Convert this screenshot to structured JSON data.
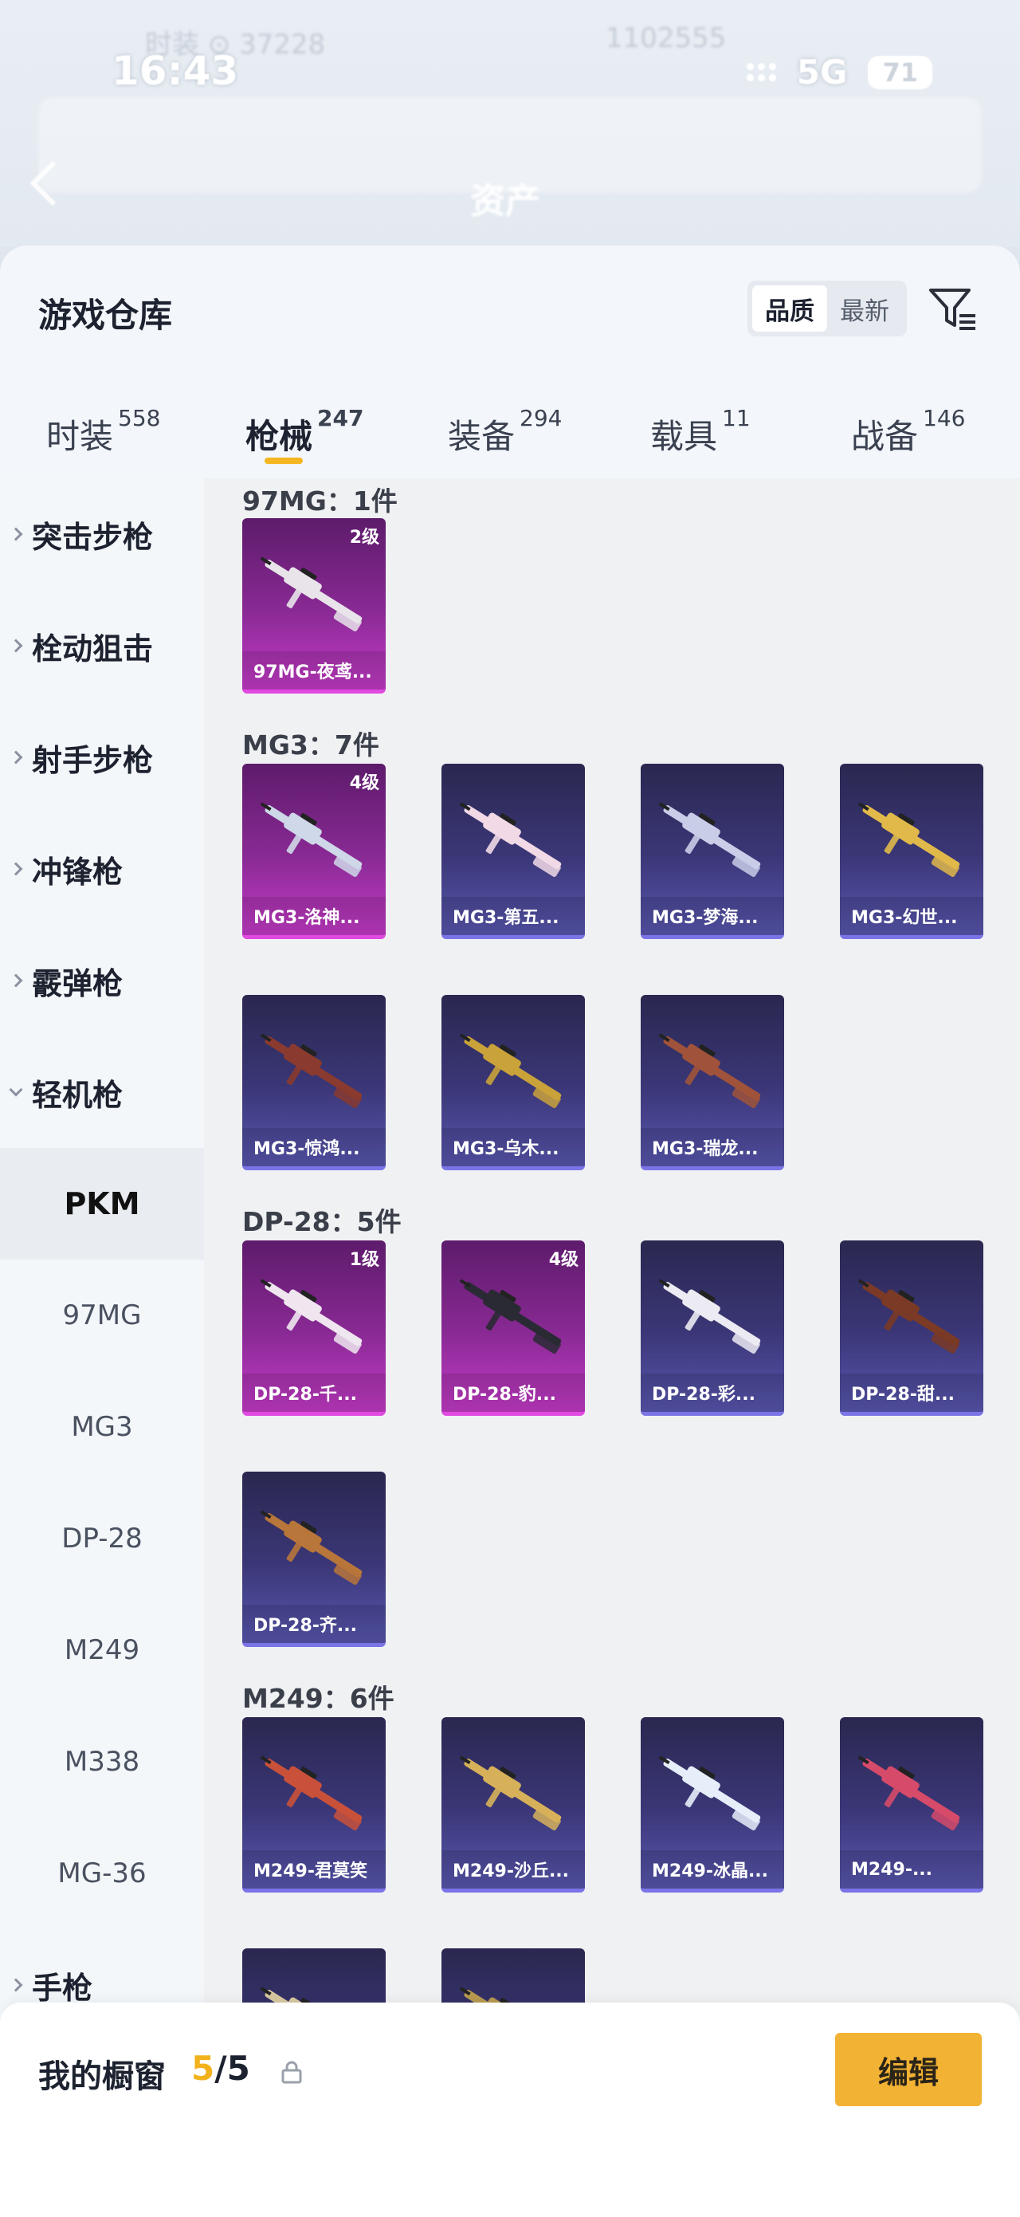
{
  "status": {
    "time": "16:43",
    "network": "5G",
    "battery": "71",
    "ghost_left": "时装 ⊙ 37228",
    "ghost_right": "1102555"
  },
  "header": {
    "ghost_title": "资产"
  },
  "warehouse": {
    "title": "游戏仓库",
    "sort_options": [
      "品质",
      "最新"
    ],
    "active_sort": "品质"
  },
  "tabs": [
    {
      "label": "时装",
      "count": "558"
    },
    {
      "label": "枪械",
      "count": "247"
    },
    {
      "label": "装备",
      "count": "294"
    },
    {
      "label": "载具",
      "count": "11"
    },
    {
      "label": "战备",
      "count": "146"
    }
  ],
  "sidebar": {
    "categories": [
      "突击步枪",
      "栓动狙击",
      "射手步枪",
      "冲锋枪",
      "霰弹枪",
      "轻机枪"
    ],
    "subitems": [
      "PKM",
      "97MG",
      "MG3",
      "DP-28",
      "M249",
      "M338",
      "MG-36"
    ],
    "after": "手枪"
  },
  "groups": [
    {
      "header": "97MG：1件",
      "items": [
        {
          "name": "97MG-夜鸢...",
          "level": "2级",
          "rarity": "purple",
          "color": "#e8e4ea"
        }
      ]
    },
    {
      "header": "MG3：7件",
      "items": [
        {
          "name": "MG3-洛神...",
          "level": "4级",
          "rarity": "purple",
          "color": "#cfd8e8"
        },
        {
          "name": "MG3-第五...",
          "level": "",
          "rarity": "blue",
          "color": "#f1d9e6"
        },
        {
          "name": "MG3-梦海...",
          "level": "",
          "rarity": "blue",
          "color": "#c9cde8"
        },
        {
          "name": "MG3-幻世...",
          "level": "",
          "rarity": "blue",
          "color": "#e0b94a"
        },
        {
          "name": "MG3-惊鸿...",
          "level": "",
          "rarity": "blue",
          "color": "#8a3a2e"
        },
        {
          "name": "MG3-乌木...",
          "level": "",
          "rarity": "blue",
          "color": "#caa23a"
        },
        {
          "name": "MG3-瑞龙...",
          "level": "",
          "rarity": "blue",
          "color": "#a0533a"
        }
      ]
    },
    {
      "header": "DP-28：5件",
      "items": [
        {
          "name": "DP-28-千...",
          "level": "1级",
          "rarity": "purple",
          "color": "#efe6ef"
        },
        {
          "name": "DP-28-豹...",
          "level": "4级",
          "rarity": "purple",
          "color": "#2a2a34"
        },
        {
          "name": "DP-28-彩...",
          "level": "",
          "rarity": "blue",
          "color": "#eceaf2"
        },
        {
          "name": "DP-28-甜...",
          "level": "",
          "rarity": "blue",
          "color": "#7a3a25"
        },
        {
          "name": "DP-28-齐...",
          "level": "",
          "rarity": "blue",
          "color": "#b8763a"
        }
      ]
    },
    {
      "header": "M249：6件",
      "items": [
        {
          "name": "M249-君莫笑",
          "level": "",
          "rarity": "blue",
          "color": "#c9513a"
        },
        {
          "name": "M249-沙丘...",
          "level": "",
          "rarity": "blue",
          "color": "#d6b15a"
        },
        {
          "name": "M249-冰晶...",
          "level": "",
          "rarity": "blue",
          "color": "#e6eefa"
        },
        {
          "name": "M249-...",
          "level": "",
          "rarity": "blue",
          "color": "#d64a6a"
        },
        {
          "name": "",
          "level": "",
          "rarity": "blue",
          "color": "#d8c8a0"
        },
        {
          "name": "",
          "level": "",
          "rarity": "blue",
          "color": "#b89a50"
        }
      ]
    }
  ],
  "showcase": {
    "label": "我的橱窗",
    "count_current": "5",
    "count_total": "/5",
    "edit_label": "编辑"
  }
}
